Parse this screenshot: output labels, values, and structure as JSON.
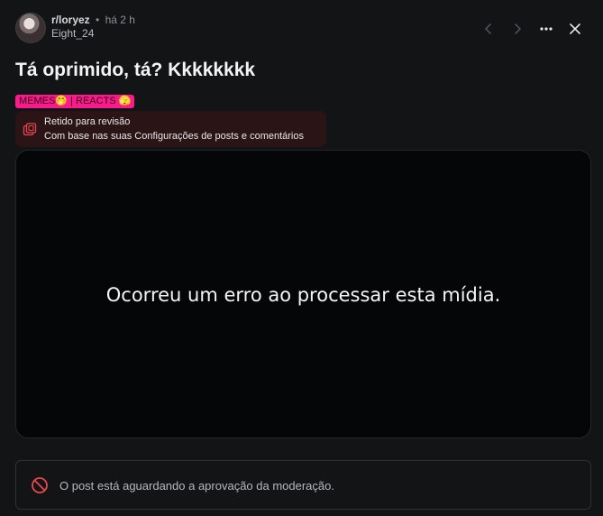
{
  "post": {
    "subreddit": "r/loryez",
    "separator": "•",
    "time": "há 2 h",
    "author": "Eight_24",
    "title": "Tá oprimido, tá? Kkkkkkkk",
    "flair": "MEMES🤭 | REACTS 🫣"
  },
  "nav": {
    "prev_icon": "chevron-left-icon",
    "next_icon": "chevron-right-icon",
    "more_icon": "more-horizontal-icon",
    "close_icon": "close-icon"
  },
  "moderation_notice": {
    "icon": "review-queue-icon",
    "title": "Retido para revisão",
    "description": "Com base nas suas Configurações de posts e comentários"
  },
  "media": {
    "error_text": "Ocorreu um erro ao processar esta mídia."
  },
  "status_bar": {
    "icon": "ban-icon",
    "message": "O post está aguardando a aprovação da moderação."
  },
  "colors": {
    "background": "#121416",
    "flair_background": "#ff1a8c",
    "notice_background": "#2a1416",
    "notice_icon": "#e5484d",
    "ban_icon": "#e5484d",
    "media_background": "#050607"
  }
}
